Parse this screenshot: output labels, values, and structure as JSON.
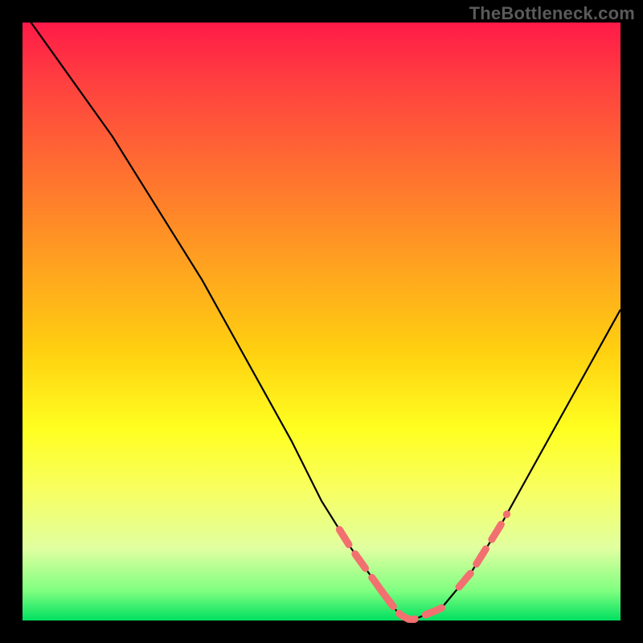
{
  "watermark": "TheBottleneck.com",
  "chart_data": {
    "type": "line",
    "title": "",
    "xlabel": "",
    "ylabel": "",
    "xlim": [
      0,
      100
    ],
    "ylim": [
      0,
      100
    ],
    "series": [
      {
        "name": "bottleneck-curve",
        "x": [
          0,
          5,
          10,
          15,
          20,
          25,
          30,
          35,
          40,
          45,
          50,
          55,
          60,
          63,
          65,
          70,
          75,
          80,
          85,
          90,
          95,
          100
        ],
        "values": [
          102,
          95,
          88,
          81,
          73,
          65,
          57,
          48,
          39,
          30,
          20,
          12,
          5,
          1,
          0,
          2,
          8,
          16,
          25,
          34,
          43,
          52
        ]
      }
    ],
    "highlight_ranges": [
      {
        "x_start": 53,
        "x_end": 62,
        "side": "left"
      },
      {
        "x_start": 60,
        "x_end": 71,
        "side": "bottom"
      },
      {
        "x_start": 73,
        "x_end": 81,
        "side": "right"
      }
    ],
    "gradient_stops": [
      {
        "pos": 0.0,
        "color": "#ff1a48"
      },
      {
        "pos": 0.55,
        "color": "#ffd010"
      },
      {
        "pos": 0.78,
        "color": "#f8ff60"
      },
      {
        "pos": 1.0,
        "color": "#00e060"
      }
    ]
  }
}
